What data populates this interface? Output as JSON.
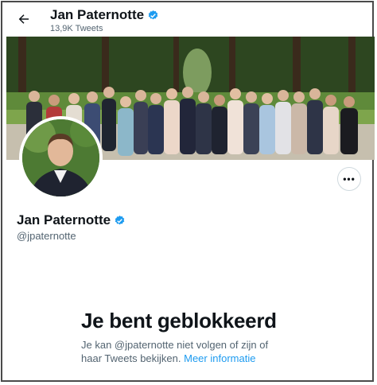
{
  "header": {
    "title": "Jan Paternotte",
    "tweet_count": "13,9K Tweets",
    "back_icon": "arrow-left-icon",
    "verified_icon": "verified-badge-icon"
  },
  "profile": {
    "name": "Jan Paternotte",
    "handle": "@jpaternotte",
    "more_label": "•••"
  },
  "blocked": {
    "title": "Je bent geblokkeerd",
    "description": "Je kan @jpaternotte niet volgen of zijn of haar Tweets bekijken.",
    "link": "Meer informatie"
  },
  "colors": {
    "accent": "#1d9bf0",
    "text_primary": "#0f1419",
    "text_secondary": "#536471",
    "border": "#cfd9de"
  }
}
